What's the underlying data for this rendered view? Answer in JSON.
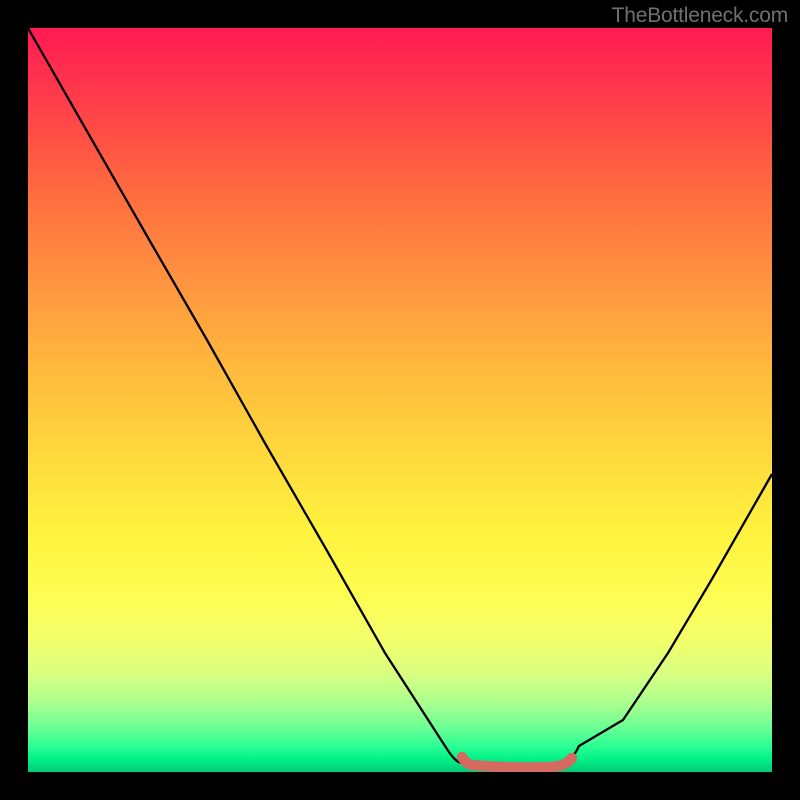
{
  "watermark": {
    "text": "TheBottleneck.com"
  },
  "chart_data": {
    "type": "line",
    "title": "",
    "xlabel": "",
    "ylabel": "",
    "x": [
      0.0,
      0.08,
      0.16,
      0.24,
      0.32,
      0.4,
      0.48,
      0.56,
      0.59,
      0.63,
      0.67,
      0.71,
      0.74,
      0.8,
      0.86,
      0.92,
      1.0
    ],
    "series": [
      {
        "name": "bottleneck-curve",
        "values": [
          1.0,
          0.86,
          0.72,
          0.58,
          0.44,
          0.3,
          0.16,
          0.035,
          0.012,
          0.004,
          0.003,
          0.004,
          0.012,
          0.07,
          0.16,
          0.26,
          0.4
        ]
      }
    ],
    "xlim": [
      0,
      1
    ],
    "ylim": [
      0,
      1
    ],
    "background_gradient": {
      "top": "#ff1a52",
      "bottom": "#02c877"
    },
    "flat_segment": {
      "x_start": 0.59,
      "x_end": 0.74,
      "color": "#d56a60",
      "stroke_width_px": 10
    }
  }
}
